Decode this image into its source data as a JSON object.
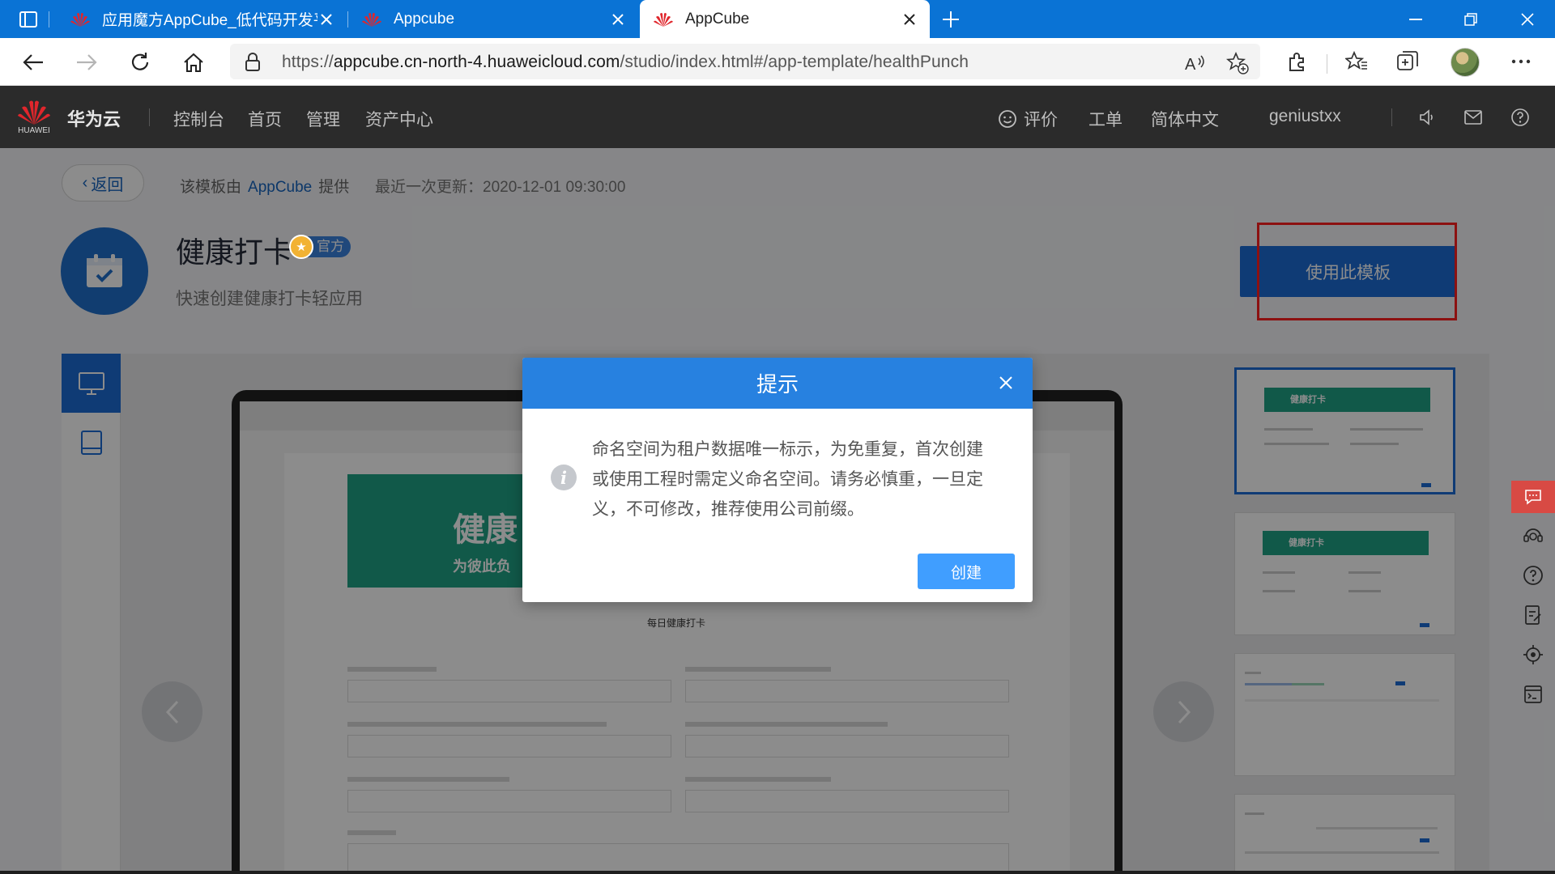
{
  "browser": {
    "tabs": [
      {
        "title": "应用魔方AppCube_低代码开发平",
        "active": false
      },
      {
        "title": "Appcube",
        "active": false
      },
      {
        "title": "AppCube",
        "active": true
      }
    ],
    "url_prefix": "https://",
    "url_host": "appcube.cn-north-4.huaweicloud.com",
    "url_path": "/studio/index.html#/app-template/healthPunch"
  },
  "header": {
    "logo_text": "HUAWEI",
    "brand": "华为云",
    "nav": [
      "控制台",
      "首页",
      "管理",
      "资产中心"
    ],
    "rating": "评价",
    "ticket": "工单",
    "language": "简体中文",
    "username": "geniustxx"
  },
  "template": {
    "back_label": "返回",
    "provider_prefix": "该模板由",
    "provider_name": "AppCube",
    "provider_suffix": "提供",
    "updated": "最近一次更新：2020-12-01 09:30:00",
    "title": "健康打卡",
    "official_tag": "官方",
    "description": "快速创建健康打卡轻应用",
    "use_button": "使用此模板"
  },
  "preview": {
    "banner_text": "健康",
    "banner_sub": "为彼此负",
    "form_title": "每日健康打卡",
    "thumb_banner": "健康打卡"
  },
  "modal": {
    "title": "提示",
    "message": "命名空间为租户数据唯一标示，为免重复，首次创建或使用工程时需定义命名空间。请务必慎重，一旦定义，不可修改，推荐使用公司前缀。",
    "confirm_label": "创建"
  },
  "colors": {
    "tab_strip": "#0a73d5",
    "header_bg": "#2b2b2b",
    "primary": "#1d6cd6",
    "modal_header": "#2781e0",
    "modal_button": "#409eff",
    "highlight": "#ff2020"
  }
}
